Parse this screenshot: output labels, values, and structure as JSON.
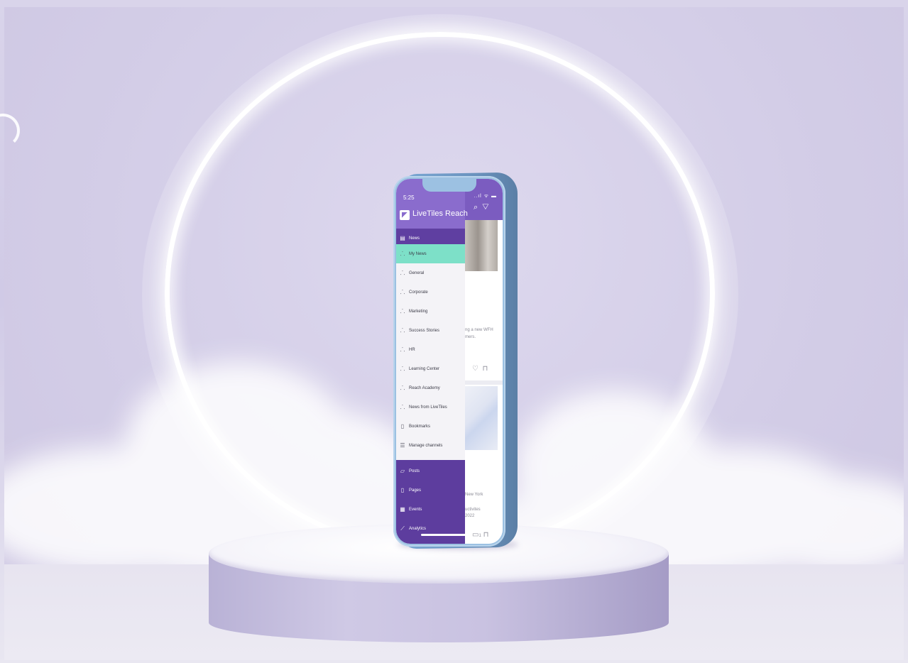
{
  "status": {
    "time": "5:25",
    "icons": "..ıl ᯤ ▬"
  },
  "app": {
    "title": "LiveTiles Reach"
  },
  "header_section": {
    "label": "News"
  },
  "channels": [
    {
      "label": "My News"
    },
    {
      "label": "General"
    },
    {
      "label": "Corporate"
    },
    {
      "label": "Marketing"
    },
    {
      "label": "Success Stories"
    },
    {
      "label": "HR"
    },
    {
      "label": "Learning Center"
    },
    {
      "label": "Reach Academy"
    },
    {
      "label": "News from LiveTiles"
    },
    {
      "label": "Bookmarks"
    },
    {
      "label": "Manage channels"
    }
  ],
  "bottom_nav": [
    {
      "label": "Posts"
    },
    {
      "label": "Pages"
    },
    {
      "label": "Events"
    },
    {
      "label": "Analytics"
    }
  ],
  "feed": {
    "snippet_1": "ng a new WFH",
    "snippet_2": "mers.",
    "snippet_3": "New York",
    "snippet_4": "uctivites",
    "snippet_5": "2022",
    "comment_count": "1"
  },
  "colors": {
    "header": "#8a6ccd",
    "section_bar": "#5f3fa1",
    "active_item": "#7de0c8",
    "bottom_nav": "#5d3d9e",
    "phone_frame": "#9cc1e2"
  }
}
